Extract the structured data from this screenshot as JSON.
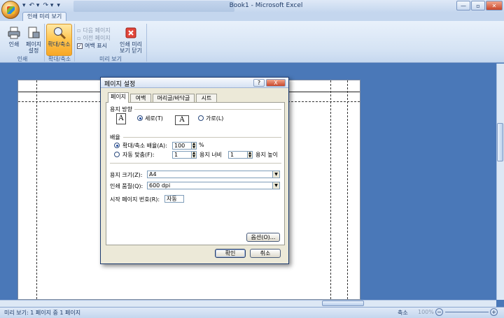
{
  "window": {
    "title": "Book1 - Microsoft Excel",
    "qat": [
      "▾",
      "↶ ▾",
      "↷ ▾",
      "▾"
    ]
  },
  "ribbon": {
    "tab": "인쇄 미리 보기",
    "groups": {
      "print": {
        "label": "인쇄",
        "print_btn": "인쇄",
        "page_setup_btn": [
          "페이지",
          "설정"
        ]
      },
      "zoom": {
        "label": "확대/축소",
        "zoom_btn": "확대/축소"
      },
      "preview": {
        "label": "미리 보기",
        "next_page": "다음 페이지",
        "prev_page": "이전 페이지",
        "show_margins": "여백 표시",
        "close_btn": [
          "인쇄 미리",
          "보기 닫기"
        ]
      }
    }
  },
  "dialog": {
    "title": "페이지 설정",
    "title_controls": [
      "?",
      "X"
    ],
    "tabs": [
      "페이지",
      "여백",
      "머리글/바닥글",
      "시트"
    ],
    "active_tab": 0,
    "orientation": {
      "label": "용지 방향",
      "portrait": "세로(T)",
      "landscape": "가로(L)",
      "selected": "portrait"
    },
    "scaling": {
      "label": "배율",
      "adjust_label": "확대/축소 배율(A):",
      "adjust_value": "100",
      "percent": "%",
      "fit_label": "자동 맞춤(F):",
      "fit_wide": "1",
      "pages_wide_label": "용지 너비",
      "fit_tall": "1",
      "pages_tall_label": "용지 높이"
    },
    "paper_size": {
      "label": "용지 크기(Z):",
      "value": "A4"
    },
    "print_quality": {
      "label": "인쇄 품질(Q):",
      "value": "600 dpi"
    },
    "first_page": {
      "label": "시작 페이지 번호(R):",
      "value": "자동"
    },
    "options_btn": "옵션(O)...",
    "ok_btn": "확인",
    "cancel_btn": "취소"
  },
  "statusbar": {
    "text": "미리 보기: 1 페이지 중 1 페이지",
    "zoom_label": "축소",
    "zoom_value": "100%"
  },
  "colors": {
    "workspace": "#4a78b8",
    "ribbon": "#d5e3f4",
    "accent": "#ffc44d"
  }
}
